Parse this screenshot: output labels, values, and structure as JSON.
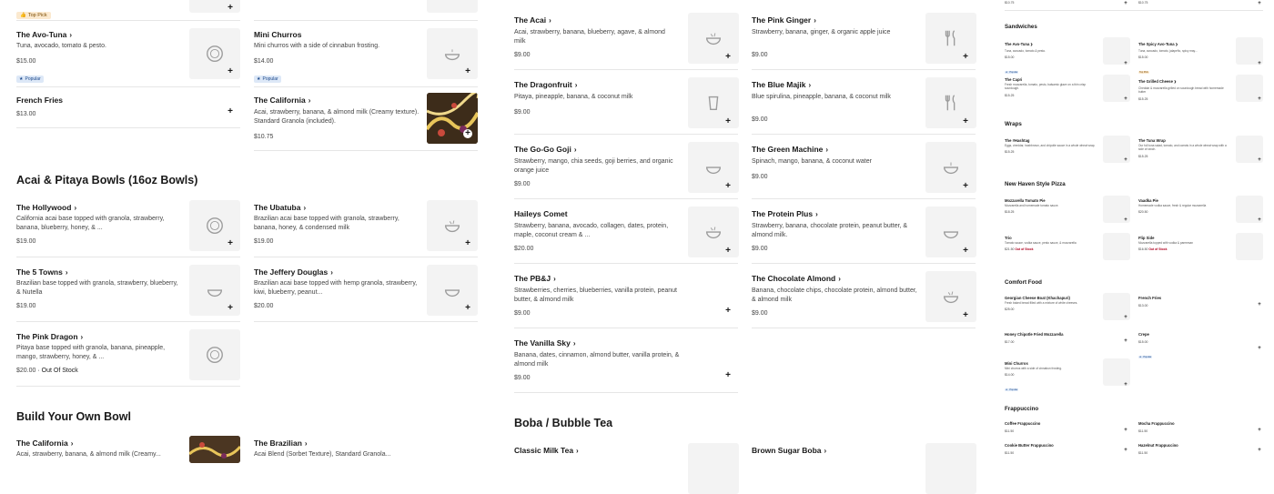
{
  "col1": {
    "top_pick_badge": "Top Pick",
    "avo_tuna": {
      "name": "The Avo-Tuna",
      "desc": "Tuna, avocado, tomato & pesto.",
      "price": "$15.00",
      "badge": "Popular"
    },
    "french_fries": {
      "name": "French Fries",
      "price": "$13.00"
    },
    "section_acai": "Acai & Pitaya Bowls (16oz Bowls)",
    "hollywood": {
      "name": "The Hollywood",
      "desc": "California acai base topped with granola, strawberry, banana, blueberry, honey, & ...",
      "price": "$19.00"
    },
    "five_towns": {
      "name": "The 5 Towns",
      "desc": "Brazilian base topped with granola, strawberry, blueberry, & Nutella",
      "price": "$19.00"
    },
    "pink_dragon": {
      "name": "The Pink Dragon",
      "desc": "Pitaya base topped with granola, banana, pineapple, mango, strawberry, honey, & ...",
      "price": "$20.00",
      "status": "Out Of Stock"
    },
    "section_build": "Build Your Own Bowl",
    "california_bottom": {
      "name": "The California",
      "desc": "Acai, strawberry, banana, & almond milk (Creamy..."
    }
  },
  "col2": {
    "mini_churros": {
      "name": "Mini Churros",
      "desc": "Mini churros with a side of cinnabun frosting.",
      "price": "$14.00",
      "badge": "Popular"
    },
    "california": {
      "name": "The California",
      "desc": "Acai, strawberry, banana, & almond milk (Creamy texture). Standard Granola (included).",
      "price": "$10.75"
    },
    "ubatuba": {
      "name": "The Ubatuba",
      "desc": "Brazilian acai base topped with granola, strawberry, banana, honey, & condensed milk",
      "price": "$19.00"
    },
    "jeffery": {
      "name": "The Jeffery Douglas",
      "desc": "Brazilian acai base topped with hemp granola, strawberry, kiwi, blueberry, peanut...",
      "price": "$20.00"
    },
    "brazilian_bottom": {
      "name": "The Brazilian",
      "desc": "Acai Blend (Sorbet Texture), Standard Granola..."
    }
  },
  "col3": {
    "acai": {
      "name": "The Acai",
      "desc": "Acai, strawberry, banana, blueberry, agave, & almond milk",
      "price": "$9.00"
    },
    "dragonfruit": {
      "name": "The Dragonfruit",
      "desc": "Pitaya, pineapple, banana, & coconut milk",
      "price": "$9.00"
    },
    "go_go_goji": {
      "name": "The Go-Go Goji",
      "desc": "Strawberry, mango, chia seeds, goji berries, and organic orange juice",
      "price": "$9.00"
    },
    "haileys": {
      "name": "Haileys Comet",
      "desc": "Strawberry, banana, avocado, collagen, dates, protein, maple, coconut cream & ...",
      "price": "$20.00"
    },
    "pbj": {
      "name": "The PB&J",
      "desc": "Strawberries, cherries, blueberries, vanilla protein, peanut butter, & almond milk",
      "price": "$9.00"
    },
    "vanilla_sky": {
      "name": "The Vanilla Sky",
      "desc": "Banana, dates, cinnamon, almond butter, vanilla protein, & almond milk",
      "price": "$9.00"
    },
    "section_boba": "Boba / Bubble Tea",
    "classic_milk_tea": {
      "name": "Classic Milk Tea"
    }
  },
  "col4": {
    "pink_ginger": {
      "name": "The Pink Ginger",
      "desc": "Strawberry, banana, ginger, & organic apple juice",
      "price": "$9.00"
    },
    "blue_majik": {
      "name": "The Blue Majik",
      "desc": "Blue spirulina, pineapple, banana, & coconut milk",
      "price": "$9.00"
    },
    "green_machine": {
      "name": "The Green Machine",
      "desc": "Spinach, mango, banana, & coconut water",
      "price": "$9.00"
    },
    "protein_plus": {
      "name": "The Protein Plus",
      "desc": "Strawberry, banana, chocolate protein, peanut butter, & almond milk.",
      "price": "$9.00"
    },
    "chocolate_almond": {
      "name": "The Chocolate Almond",
      "desc": "Banana, chocolate chips, chocolate protein, almond butter, & almond milk",
      "price": "$9.00"
    },
    "brown_sugar_boba": {
      "name": "Brown Sugar Boba"
    }
  },
  "mini": {
    "top_prices": [
      "$10.75",
      "$10.75"
    ],
    "sandwiches": "Sandwiches",
    "avo_tuna": {
      "name": "The Avo-Tuna",
      "desc": "Tuna, avocado, tomato & pesto.",
      "price": "$15.00",
      "badge": "Popular"
    },
    "spicy_avo_tuna": {
      "name": "The Spicy Avo-Tuna",
      "desc": "Tuna, avocado, tomato, jalapeño, spicy may...",
      "price": "$15.00",
      "badge": "Top Pick"
    },
    "capri": {
      "name": "The Capri",
      "desc": "Fresh mozzarella, tomato, pesto, balsamic glaze on a thin crisp sourdough.",
      "price": "$15.25"
    },
    "grilled_cheese": {
      "name": "The Grilled Cheese",
      "desc": "Cheddar & mozzarella grilled on sourdough bread with homemade butter",
      "price": "$15.25"
    },
    "wraps": "Wraps",
    "hashtag": {
      "name": "The #Hashtag",
      "desc": "Eggs, cheddar, hashbrown, and chipotle sauce in a whole wheat wrap.",
      "price": "$15.25"
    },
    "tuna_wrap": {
      "name": "The Tuna Wrap",
      "desc": "Our full tuna salad, tomato, and carrots in a whole wheat wrap with a side of ranch.",
      "price": "$15.25"
    },
    "pizza": "New Haven Style Pizza",
    "mozz_tomato": {
      "name": "Mozzarella Tomato Pie",
      "desc": "Mozzarella and homemade tomato sauce.",
      "price": "$18.25"
    },
    "vaadka": {
      "name": "Vaadka Pie",
      "desc": "Homemade vodka sauce, fresh & regular mozzarella",
      "price": "$20.50"
    },
    "trio": {
      "name": "Trio",
      "desc": "Tomato sauce, vodka sauce, pesto sauce, & mozzarella",
      "price": "$21.50",
      "status": "Out of Stock"
    },
    "flip_side": {
      "name": "Flip Side",
      "desc": "Mozzarella topped with vodka & parmesan",
      "price": "$16.50",
      "status": "Out of Stock"
    },
    "comfort": "Comfort Food",
    "georgian": {
      "name": "Georgian Cheese Boat (Khachapuri)",
      "desc": "Fresh baked bread filled with a mixture of white cheeses.",
      "price": "$25.00"
    },
    "fries": {
      "name": "French Fries",
      "price": "$13.00"
    },
    "honey_chipotle": {
      "name": "Honey Chipotle Fried Mozzarella",
      "price": "$17.00"
    },
    "crepe": {
      "name": "Crepe",
      "price": "$15.00",
      "badge": "Popular"
    },
    "churros": {
      "name": "Mini Churros",
      "desc": "Mini churros with a side of cinnabun frosting.",
      "price": "$14.00",
      "badge": "Popular"
    },
    "frappuccino": "Frappuccino",
    "coffee_frapp": {
      "name": "Coffee Frappuccino",
      "price": "$11.50"
    },
    "mocha_frapp": {
      "name": "Mocha Frappuccino",
      "price": "$11.50"
    },
    "cookie_frapp": {
      "name": "Cookie Butter Frappuccino",
      "price": "$11.50"
    },
    "hazelnut_frapp": {
      "name": "Hazelnut Frappuccino",
      "price": "$11.50"
    }
  }
}
